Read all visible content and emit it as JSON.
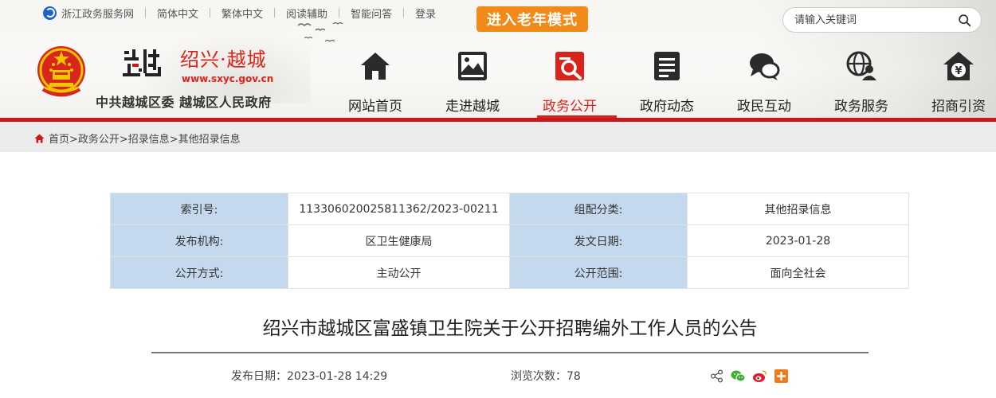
{
  "topbar": {
    "portal": "浙江政务服务网",
    "links": [
      "简体中文",
      "繁体中文",
      "阅读辅助",
      "智能问答",
      "登录"
    ],
    "elder_mode": "进入老年模式"
  },
  "search": {
    "placeholder": "请输入关键词"
  },
  "brand": {
    "name": "绍兴·越城",
    "url": "www.sxyc.gov.cn",
    "org": "中共越城区委 越城区人民政府"
  },
  "nav": [
    {
      "label": "网站首页",
      "icon": "home-icon"
    },
    {
      "label": "走进越城",
      "icon": "picture-icon"
    },
    {
      "label": "政务公开",
      "icon": "document-search-icon",
      "active": true
    },
    {
      "label": "政府动态",
      "icon": "news-icon"
    },
    {
      "label": "政民互动",
      "icon": "chat-icon"
    },
    {
      "label": "政务服务",
      "icon": "globe-user-icon"
    },
    {
      "label": "招商引资",
      "icon": "yen-house-icon"
    }
  ],
  "breadcrumb": "首页>政务公开>招录信息>其他招录信息",
  "info": {
    "index_label": "索引号:",
    "index_value": "11330602002581136​2/2023-00211",
    "category_label": "组配分类:",
    "category_value": "其他招录信息",
    "publisher_label": "发布机构:",
    "publisher_value": "区卫生健康局",
    "date_label": "发文日期:",
    "date_value": "2023-01-28",
    "mode_label": "公开方式:",
    "mode_value": "主动公开",
    "scope_label": "公开范围:",
    "scope_value": "面向全社会"
  },
  "article": {
    "title": "绍兴市越城区富盛镇卫生院关于公开招聘编外工作人员的公告",
    "publish_date": "发布日期：2023-01-28 14:29",
    "views": "浏览次数：78"
  },
  "colors": {
    "accent_red": "#c9171e",
    "elder_orange": "#f28a1a",
    "table_key_bg": "#c5d9ee"
  }
}
